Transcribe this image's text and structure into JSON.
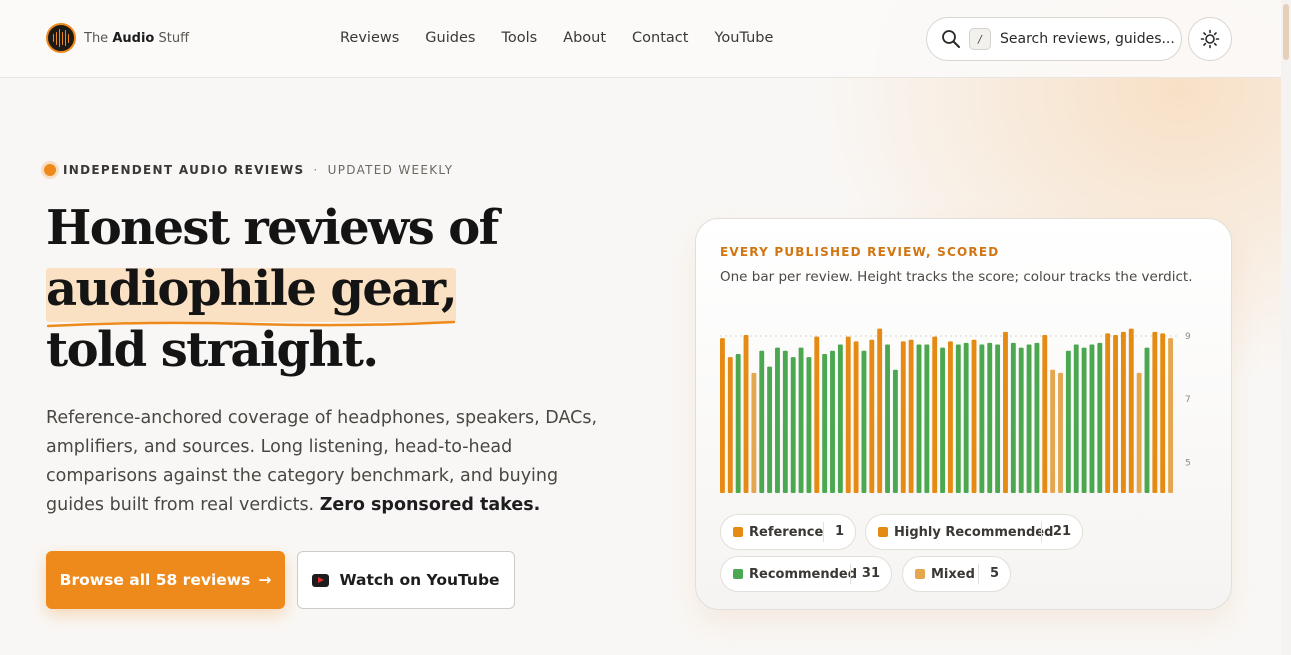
{
  "brand": {
    "prefix": "The",
    "bold": "Audio",
    "suffix": "Stuff"
  },
  "nav": [
    "Reviews",
    "Guides",
    "Tools",
    "About",
    "Contact",
    "YouTube"
  ],
  "search": {
    "key": "/",
    "placeholder": "Search reviews, guides..."
  },
  "hero": {
    "eyebrow_main": "INDEPENDENT AUDIO REVIEWS",
    "eyebrow_sep": "·",
    "eyebrow_sub": "UPDATED WEEKLY",
    "headline_1": "Honest reviews of",
    "headline_2": "audiophile gear,",
    "headline_3": "told straight.",
    "lede": "Reference-anchored coverage of headphones, speakers, DACs, amplifiers, and sources. Long listening, head-to-head comparisons against the category benchmark, and buying guides built from real verdicts.",
    "lede_bold": "Zero sponsored takes.",
    "primary_button": "Browse all 58 reviews",
    "primary_arrow": "→",
    "secondary_button": "Watch on YouTube"
  },
  "card": {
    "eyebrow": "EVERY PUBLISHED REVIEW, SCORED",
    "subtitle": "One bar per review. Height tracks the score; colour tracks the verdict."
  },
  "colors": {
    "accent": "#ee8a1c",
    "highly_recommended": "#e58a12",
    "recommended": "#4ca751",
    "mixed": "#e4a64f"
  },
  "legend": [
    {
      "label": "Reference",
      "count": "1",
      "color": "#e58a12"
    },
    {
      "label": "Highly Recommended",
      "count": "21",
      "color": "#e58a12"
    },
    {
      "label": "Recommended",
      "count": "31",
      "color": "#4ca751"
    },
    {
      "label": "Mixed",
      "count": "5",
      "color": "#e4a64f"
    }
  ],
  "chart_data": {
    "type": "bar",
    "title": "EVERY PUBLISHED REVIEW, SCORED",
    "subtitle": "One bar per review. Height tracks the score; colour tracks the verdict.",
    "yticks": [
      5,
      7,
      9
    ],
    "ylim": [
      4,
      9
    ],
    "reference_line": 9,
    "grid": false,
    "bars": [
      {
        "v": 8.9,
        "c": "hr"
      },
      {
        "v": 8.3,
        "c": "hr"
      },
      {
        "v": 8.4,
        "c": "rec"
      },
      {
        "v": 9.0,
        "c": "hr"
      },
      {
        "v": 7.8,
        "c": "mix"
      },
      {
        "v": 8.5,
        "c": "rec"
      },
      {
        "v": 8.0,
        "c": "rec"
      },
      {
        "v": 8.6,
        "c": "rec"
      },
      {
        "v": 8.5,
        "c": "rec"
      },
      {
        "v": 8.3,
        "c": "rec"
      },
      {
        "v": 8.6,
        "c": "rec"
      },
      {
        "v": 8.3,
        "c": "rec"
      },
      {
        "v": 8.95,
        "c": "hr"
      },
      {
        "v": 8.4,
        "c": "rec"
      },
      {
        "v": 8.5,
        "c": "rec"
      },
      {
        "v": 8.7,
        "c": "rec"
      },
      {
        "v": 8.95,
        "c": "hr"
      },
      {
        "v": 8.8,
        "c": "hr"
      },
      {
        "v": 8.5,
        "c": "rec"
      },
      {
        "v": 8.85,
        "c": "hr"
      },
      {
        "v": 9.2,
        "c": "hr"
      },
      {
        "v": 8.7,
        "c": "rec"
      },
      {
        "v": 7.9,
        "c": "rec"
      },
      {
        "v": 8.8,
        "c": "hr"
      },
      {
        "v": 8.85,
        "c": "hr"
      },
      {
        "v": 8.7,
        "c": "rec"
      },
      {
        "v": 8.7,
        "c": "rec"
      },
      {
        "v": 8.95,
        "c": "hr"
      },
      {
        "v": 8.6,
        "c": "rec"
      },
      {
        "v": 8.8,
        "c": "hr"
      },
      {
        "v": 8.7,
        "c": "rec"
      },
      {
        "v": 8.75,
        "c": "rec"
      },
      {
        "v": 8.85,
        "c": "hr"
      },
      {
        "v": 8.7,
        "c": "rec"
      },
      {
        "v": 8.75,
        "c": "rec"
      },
      {
        "v": 8.7,
        "c": "rec"
      },
      {
        "v": 9.1,
        "c": "hr"
      },
      {
        "v": 8.75,
        "c": "rec"
      },
      {
        "v": 8.6,
        "c": "rec"
      },
      {
        "v": 8.7,
        "c": "rec"
      },
      {
        "v": 8.75,
        "c": "rec"
      },
      {
        "v": 9.0,
        "c": "hr"
      },
      {
        "v": 7.9,
        "c": "mix"
      },
      {
        "v": 7.8,
        "c": "mix"
      },
      {
        "v": 8.5,
        "c": "rec"
      },
      {
        "v": 8.7,
        "c": "rec"
      },
      {
        "v": 8.6,
        "c": "rec"
      },
      {
        "v": 8.7,
        "c": "rec"
      },
      {
        "v": 8.75,
        "c": "rec"
      },
      {
        "v": 9.05,
        "c": "hr"
      },
      {
        "v": 9.0,
        "c": "hr"
      },
      {
        "v": 9.1,
        "c": "hr"
      },
      {
        "v": 9.2,
        "c": "ref"
      },
      {
        "v": 7.8,
        "c": "mix"
      },
      {
        "v": 8.6,
        "c": "rec"
      },
      {
        "v": 9.1,
        "c": "hr"
      },
      {
        "v": 9.05,
        "c": "hr"
      },
      {
        "v": 8.9,
        "c": "mix"
      }
    ]
  }
}
